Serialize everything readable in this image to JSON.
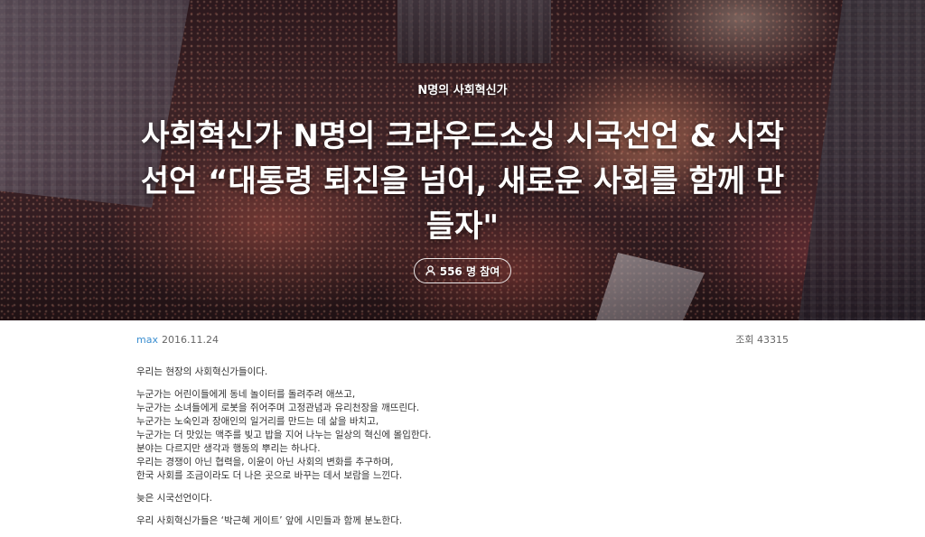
{
  "hero": {
    "category": "N명의 사회혁신가",
    "title": "사회혁신가 N명의 크라우드소싱 시국선언 & 시작선언 “대통령 퇴진을 넘어, 새로운 사회를 함께 만들자\"",
    "participants": "556 명 참여",
    "icon": "user-icon"
  },
  "meta": {
    "author": "max",
    "date": "2016.11.24",
    "views": "조회 43315"
  },
  "body": {
    "intro": "우리는 현장의 사회혁신가들이다.",
    "para1": [
      "누군가는 어린이들에게 동네 놀이터를 돌려주려 애쓰고,",
      "누군가는 소녀들에게 로봇을 쥐어주며 고정관념과 유리천장을 깨뜨린다.",
      "누군가는 노숙인과 장애인의 일거리를 만드는 데 삶을 바치고,",
      "누군가는 더 맛있는 맥주를 빚고 밥을 지어 나누는 일상의 혁신에 몰입한다.",
      "분야는 다르지만 생각과 행동의 뿌리는 하나다.",
      "우리는 경쟁이 아닌 협력을, 이윤이 아닌 사회의 변화를 추구하며,",
      "한국 사회를 조금이라도 더 나은 곳으로 바꾸는 데서 보람을 느낀다."
    ],
    "late": "늦은 시국선언이다.",
    "partial": "우리 사회혁신가들은 ‘박근혜 게이트’ 앞에 시민들과 함께 분노한다."
  }
}
